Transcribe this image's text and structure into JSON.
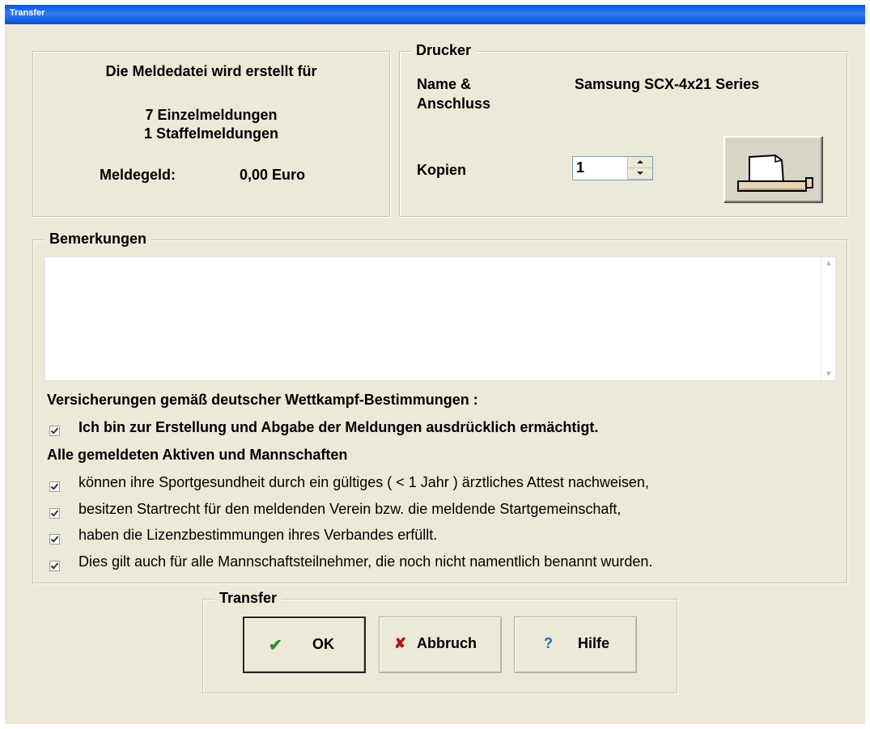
{
  "window": {
    "title": "Transfer"
  },
  "summary": {
    "heading": "Die Meldedatei wird erstellt für",
    "individual": "7 Einzelmeldungen",
    "relay": "1 Staffelmeldungen",
    "fee_label": "Meldegeld:",
    "fee_value": "0,00 Euro"
  },
  "printer": {
    "legend": "Drucker",
    "name_label_1": "Name &",
    "name_label_2": "Anschluss",
    "name_value": "Samsung SCX-4x21 Series",
    "copies_label": "Kopien",
    "copies_value": "1",
    "print_icon": "printer-icon"
  },
  "remarks": {
    "legend": "Bemerkungen",
    "value": ""
  },
  "assurances": {
    "heading": "Versicherungen gemäß deutscher Wettkampf-Bestimmungen :",
    "authorized": "Ich bin zur Erstellung und Abgabe der Meldungen ausdrücklich ermächtigt.",
    "all_heading": "Alle gemeldeten Aktiven und Mannschaften",
    "items": [
      "können ihre Sportgesundheit durch ein gültiges ( < 1 Jahr ) ärztliches Attest nachweisen,",
      "besitzen Startrecht für den meldenden Verein bzw. die meldende Startgemeinschaft,",
      "haben die Lizenzbestimmungen ihres Verbandes erfüllt.",
      "Dies gilt auch für alle Mannschaftsteilnehmer, die noch nicht namentlich benannt wurden."
    ]
  },
  "transfer": {
    "legend": "Transfer",
    "ok": "OK",
    "cancel": "Abbruch",
    "help": "Hilfe",
    "ok_icon": "✔",
    "cancel_icon": "✘",
    "help_icon": "?",
    "colors": {
      "ok": "#2E8B2E",
      "cancel": "#B01818",
      "help": "#1F6FB5"
    }
  }
}
